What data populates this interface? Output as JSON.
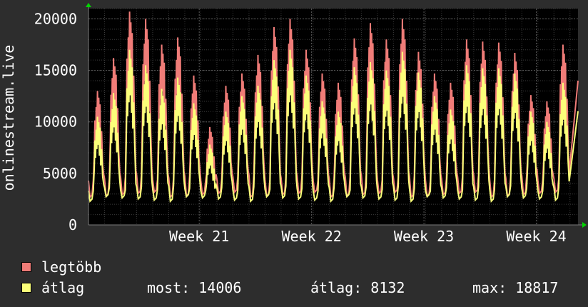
{
  "chart_data": {
    "type": "line",
    "ylabel": "onlinestream.live",
    "ylim": [
      0,
      21000
    ],
    "yticks": [
      0,
      5000,
      10000,
      15000,
      20000
    ],
    "ytick_labels": [
      "0",
      "5000",
      "10000",
      "15000",
      "20000"
    ],
    "xticks": [
      {
        "label": "Week 21",
        "day": 6.9
      },
      {
        "label": "Week 22",
        "day": 13.9
      },
      {
        "label": "Week 23",
        "day": 20.9
      },
      {
        "label": "Week 24",
        "day": 27.9
      }
    ],
    "xrange_days": [
      0,
      30.5
    ],
    "grid": true,
    "background": "#000000",
    "series": [
      {
        "name": "legtöbb",
        "color": "#f07c78",
        "daily_peaks": [
          13000,
          16200,
          20700,
          20000,
          17500,
          18200,
          14500,
          9500,
          13500,
          14700,
          16500,
          19200,
          20000,
          17000,
          14700,
          13800,
          18100,
          19600,
          18000,
          20000,
          16800,
          14700,
          13800,
          18000,
          17800,
          17700,
          16700,
          12600,
          12000,
          17500
        ]
      },
      {
        "name": "átlag",
        "color": "#fbff79",
        "daily_peaks": [
          10500,
          12800,
          17000,
          15500,
          13200,
          14300,
          11800,
          7800,
          11000,
          12500,
          13500,
          16000,
          17000,
          14500,
          12000,
          11000,
          15300,
          15800,
          15000,
          16800,
          14800,
          12500,
          11200,
          15500,
          15200,
          15200,
          14700,
          11000,
          10000,
          13800
        ]
      }
    ],
    "summary": {
      "most_label": "most:",
      "most_value": "14006",
      "avg_label": "átlag:",
      "avg_value": "8132",
      "max_label": "max:",
      "max_value": "18817"
    }
  },
  "colors": {
    "arrow": "#00d400",
    "grid": "#5a5a5a",
    "minor_grid": "#3a3a3a",
    "axis_text": "#ffffff"
  }
}
